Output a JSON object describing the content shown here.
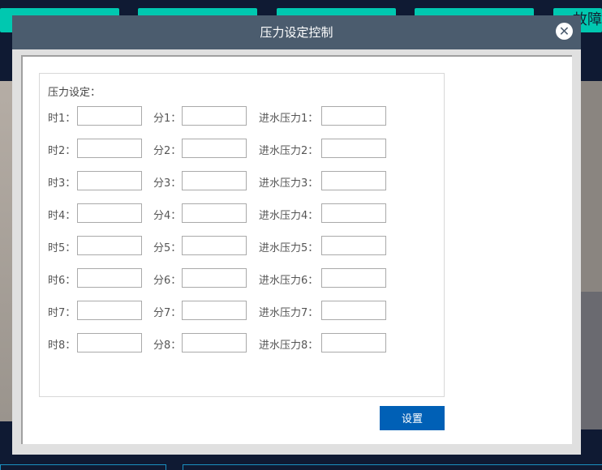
{
  "nav": [
    {
      "label": ""
    },
    {
      "label": ""
    },
    {
      "label": ""
    },
    {
      "label": ""
    },
    {
      "label": "故障"
    }
  ],
  "modal": {
    "title": "压力设定控制",
    "close_icon": "close-icon",
    "section_label": "压力设定：",
    "rows": [
      {
        "hour": "时1：",
        "minute": "分1：",
        "pressure": "进水压力1："
      },
      {
        "hour": "时2：",
        "minute": "分2：",
        "pressure": "进水压力2："
      },
      {
        "hour": "时3：",
        "minute": "分3：",
        "pressure": "进水压力3："
      },
      {
        "hour": "时4：",
        "minute": "分4：",
        "pressure": "进水压力4："
      },
      {
        "hour": "时5：",
        "minute": "分5：",
        "pressure": "进水压力5："
      },
      {
        "hour": "时6：",
        "minute": "分6：",
        "pressure": "进水压力6："
      },
      {
        "hour": "时7：",
        "minute": "分7：",
        "pressure": "进水压力7："
      },
      {
        "hour": "时8：",
        "minute": "分8：",
        "pressure": "进水压力8："
      }
    ],
    "submit_label": "设置"
  },
  "colors": {
    "header": "#4b5c6e",
    "button": "#0060b6",
    "nav": "#00c8b0",
    "background": "#0f1a33"
  }
}
